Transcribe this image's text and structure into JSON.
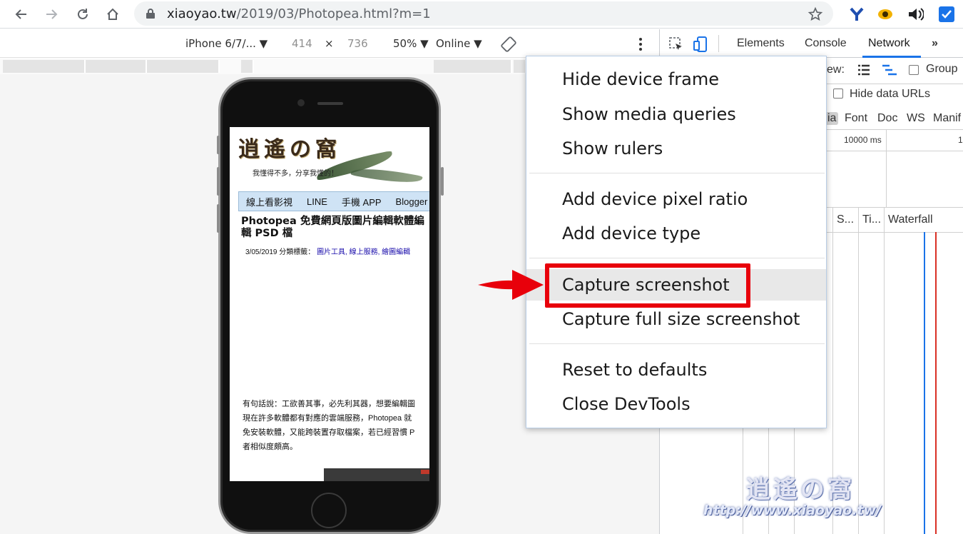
{
  "browser": {
    "url_host": "xiaoyao.tw",
    "url_path": "/2019/03/Photopea.html?m=1"
  },
  "device_toolbar": {
    "device": "iPhone 6/7/...",
    "width": "414",
    "times": "×",
    "height": "736",
    "zoom": "50%",
    "network": "Online"
  },
  "devtools": {
    "tabs": [
      "Elements",
      "Console",
      "Network"
    ],
    "more": "»",
    "view_label": "ew:",
    "group_label": "Group",
    "hide_data_urls": "Hide data URLs",
    "filters": [
      "ia",
      "Font",
      "Doc",
      "WS",
      "Manif"
    ],
    "timeline_tick_1": "10000 ms",
    "timeline_tick_2": "1",
    "columns": [
      "S...",
      "Ti...",
      "Waterfall"
    ]
  },
  "context_menu": {
    "group1": [
      "Hide device frame",
      "Show media queries",
      "Show rulers"
    ],
    "group2": [
      "Add device pixel ratio",
      "Add device type"
    ],
    "group3": [
      "Capture screenshot",
      "Capture full size screenshot"
    ],
    "group4": [
      "Reset to defaults",
      "Close DevTools"
    ],
    "highlighted_index": 0
  },
  "mobile_page": {
    "logo": "逍遙の窩",
    "tagline": "我懂得不多，分享我懂的！",
    "nav": [
      "線上看影視",
      "LINE",
      "手機 APP",
      "Blogger"
    ],
    "post_title": "Photopea 免費網頁版圖片編輯軟體編輯 PSD 檔",
    "post_date": "3/05/2019",
    "post_tag_label": "分類標籤：",
    "post_tags": "圖片工具, 線上服務, 繪圖編輯",
    "body_lines": [
      "有句話說：工欲善其事，必先利其器，想要編輯圖",
      "現在許多軟體都有對應的雲端服務，Photopea 就",
      "免安裝軟體，又能跨裝置存取檔案，若已經習慣 P",
      "者相似度頗高。"
    ]
  },
  "watermark": {
    "logo": "逍遙の窩",
    "url": "http://www.xiaoyao.tw/"
  },
  "colors": {
    "accent_red": "#e8000b",
    "devtools_blue": "#1a73e8"
  }
}
